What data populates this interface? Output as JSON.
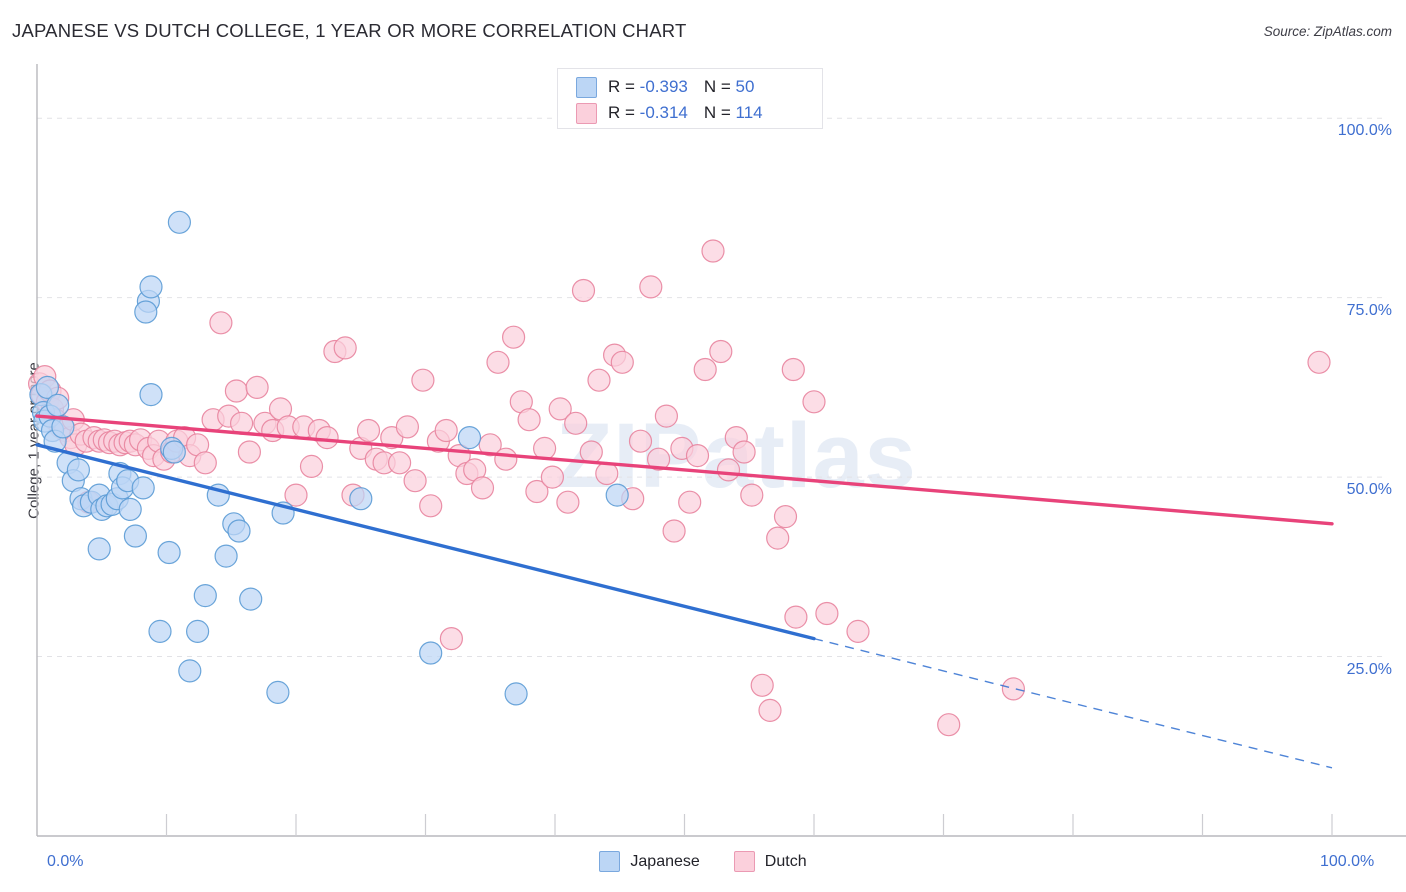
{
  "title": "JAPANESE VS DUTCH COLLEGE, 1 YEAR OR MORE CORRELATION CHART",
  "source": "Source: ZipAtlas.com",
  "watermark": "ZIPatlas",
  "stats": {
    "rows": [
      {
        "series": "Japanese",
        "r_label": "R = ",
        "r_value": "-0.393",
        "n_label": "N = ",
        "n_value": "50",
        "color": "#bcd6f5"
      },
      {
        "series": "Dutch",
        "r_label": "R = ",
        "r_value": "-0.314",
        "n_label": "N = ",
        "n_value": "114",
        "color": "#fbd0dc"
      }
    ]
  },
  "legend": {
    "position": "bottom-center",
    "entries": [
      {
        "label": "Japanese",
        "color": "#bcd6f5",
        "stroke": "#5b9bd5"
      },
      {
        "label": "Dutch",
        "color": "#fbd0dc",
        "stroke": "#e8849f"
      }
    ]
  },
  "chart_data": {
    "type": "scatter",
    "title": "JAPANESE VS DUTCH COLLEGE, 1 YEAR OR MORE CORRELATION CHART",
    "xlabel": "",
    "ylabel": "College, 1 year or more",
    "xlim": [
      0,
      100
    ],
    "ylim": [
      0,
      107
    ],
    "grid": true,
    "xticks": [
      0,
      100
    ],
    "xtick_labels": [
      "0.0%",
      "100.0%"
    ],
    "yticks": [
      25,
      50,
      75,
      100
    ],
    "ytick_labels": [
      "25.0%",
      "50.0%",
      "75.0%",
      "100.0%"
    ],
    "series": [
      {
        "name": "Japanese",
        "color": "#bcd6f5",
        "stroke": "#5b9bd5",
        "r": -0.393,
        "n": 50,
        "trendline": {
          "x0": 0,
          "y0": 54.5,
          "x1": 60,
          "y1": 27.5,
          "x2": 100,
          "y2": 9.5,
          "solid_to_x": 60,
          "color": "#2f6fd0"
        },
        "points": [
          [
            0.3,
            61.5
          ],
          [
            0.5,
            59.0
          ],
          [
            0.6,
            57.8
          ],
          [
            0.8,
            62.5
          ],
          [
            1.0,
            58.5
          ],
          [
            1.2,
            56.5
          ],
          [
            1.4,
            55.0
          ],
          [
            1.6,
            60.0
          ],
          [
            2.0,
            57.0
          ],
          [
            2.4,
            52.0
          ],
          [
            2.8,
            49.5
          ],
          [
            3.2,
            51.0
          ],
          [
            3.4,
            47.0
          ],
          [
            3.6,
            46.0
          ],
          [
            4.2,
            46.5
          ],
          [
            4.8,
            47.5
          ],
          [
            5.0,
            45.5
          ],
          [
            5.4,
            46.0
          ],
          [
            5.8,
            46.2
          ],
          [
            6.2,
            47.0
          ],
          [
            6.4,
            50.5
          ],
          [
            6.6,
            48.5
          ],
          [
            7.0,
            49.5
          ],
          [
            7.2,
            45.5
          ],
          [
            4.8,
            40.0
          ],
          [
            7.6,
            41.8
          ],
          [
            8.2,
            48.5
          ],
          [
            8.6,
            74.5
          ],
          [
            8.8,
            76.5
          ],
          [
            8.4,
            73.0
          ],
          [
            8.8,
            61.5
          ],
          [
            9.5,
            28.5
          ],
          [
            10.2,
            39.5
          ],
          [
            10.4,
            54.0
          ],
          [
            10.6,
            53.5
          ],
          [
            11.0,
            85.5
          ],
          [
            11.8,
            23.0
          ],
          [
            12.4,
            28.5
          ],
          [
            13.0,
            33.5
          ],
          [
            14.0,
            47.5
          ],
          [
            14.6,
            39.0
          ],
          [
            15.2,
            43.5
          ],
          [
            15.6,
            42.5
          ],
          [
            16.5,
            33.0
          ],
          [
            18.6,
            20.0
          ],
          [
            19.0,
            45.0
          ],
          [
            25.0,
            47.0
          ],
          [
            30.4,
            25.5
          ],
          [
            33.4,
            55.5
          ],
          [
            37.0,
            19.8
          ],
          [
            44.8,
            47.5
          ]
        ]
      },
      {
        "name": "Dutch",
        "color": "#fbd0dc",
        "stroke": "#e8849f",
        "r": -0.314,
        "n": 114,
        "trendline": {
          "x0": 0,
          "y0": 58.5,
          "x1": 100,
          "y1": 43.5,
          "color": "#e8437a"
        },
        "points": [
          [
            0.2,
            63.0
          ],
          [
            0.4,
            61.5
          ],
          [
            0.6,
            64.0
          ],
          [
            0.8,
            60.5
          ],
          [
            1.0,
            62.0
          ],
          [
            1.2,
            59.5
          ],
          [
            1.4,
            58.0
          ],
          [
            1.6,
            61.0
          ],
          [
            1.8,
            57.0
          ],
          [
            2.2,
            56.5
          ],
          [
            2.6,
            55.5
          ],
          [
            2.8,
            58.0
          ],
          [
            3.0,
            54.5
          ],
          [
            3.4,
            56.0
          ],
          [
            3.8,
            55.0
          ],
          [
            4.0,
            46.5
          ],
          [
            4.4,
            55.5
          ],
          [
            4.8,
            55.0
          ],
          [
            5.2,
            55.2
          ],
          [
            5.6,
            54.8
          ],
          [
            6.0,
            55.0
          ],
          [
            6.4,
            54.5
          ],
          [
            6.8,
            54.8
          ],
          [
            7.2,
            55.0
          ],
          [
            7.6,
            54.5
          ],
          [
            8.0,
            55.2
          ],
          [
            8.6,
            54.0
          ],
          [
            9.0,
            53.0
          ],
          [
            9.4,
            55.0
          ],
          [
            9.8,
            52.5
          ],
          [
            10.4,
            53.5
          ],
          [
            10.8,
            55.0
          ],
          [
            11.4,
            55.5
          ],
          [
            11.8,
            53.0
          ],
          [
            12.4,
            54.5
          ],
          [
            13.0,
            52.0
          ],
          [
            13.6,
            58.0
          ],
          [
            14.2,
            71.5
          ],
          [
            14.8,
            58.5
          ],
          [
            15.4,
            62.0
          ],
          [
            15.8,
            57.5
          ],
          [
            16.4,
            53.5
          ],
          [
            17.0,
            62.5
          ],
          [
            17.6,
            57.5
          ],
          [
            18.2,
            56.5
          ],
          [
            18.8,
            59.5
          ],
          [
            19.4,
            57.0
          ],
          [
            20.0,
            47.5
          ],
          [
            20.6,
            57.0
          ],
          [
            21.2,
            51.5
          ],
          [
            21.8,
            56.5
          ],
          [
            22.4,
            55.5
          ],
          [
            23.0,
            67.5
          ],
          [
            23.8,
            68.0
          ],
          [
            24.4,
            47.5
          ],
          [
            25.0,
            54.0
          ],
          [
            25.6,
            56.5
          ],
          [
            26.2,
            52.5
          ],
          [
            26.8,
            52.0
          ],
          [
            27.4,
            55.5
          ],
          [
            28.0,
            52.0
          ],
          [
            28.6,
            57.0
          ],
          [
            29.2,
            49.5
          ],
          [
            29.8,
            63.5
          ],
          [
            30.4,
            46.0
          ],
          [
            31.0,
            55.0
          ],
          [
            31.6,
            56.5
          ],
          [
            32.0,
            27.5
          ],
          [
            32.6,
            53.0
          ],
          [
            33.2,
            50.5
          ],
          [
            33.8,
            51.0
          ],
          [
            34.4,
            48.5
          ],
          [
            35.0,
            54.5
          ],
          [
            35.6,
            66.0
          ],
          [
            36.2,
            52.5
          ],
          [
            36.8,
            69.5
          ],
          [
            37.4,
            60.5
          ],
          [
            38.0,
            58.0
          ],
          [
            38.6,
            48.0
          ],
          [
            39.2,
            54.0
          ],
          [
            39.8,
            50.0
          ],
          [
            40.4,
            59.5
          ],
          [
            41.0,
            46.5
          ],
          [
            41.6,
            57.5
          ],
          [
            42.2,
            76.0
          ],
          [
            42.8,
            53.5
          ],
          [
            43.4,
            63.5
          ],
          [
            44.0,
            50.5
          ],
          [
            44.6,
            67.0
          ],
          [
            45.2,
            66.0
          ],
          [
            46.0,
            47.0
          ],
          [
            46.6,
            55.0
          ],
          [
            47.4,
            76.5
          ],
          [
            48.0,
            52.5
          ],
          [
            48.6,
            58.5
          ],
          [
            49.2,
            42.5
          ],
          [
            49.8,
            54.0
          ],
          [
            50.4,
            46.5
          ],
          [
            51.0,
            53.0
          ],
          [
            51.6,
            65.0
          ],
          [
            52.2,
            81.5
          ],
          [
            52.8,
            67.5
          ],
          [
            53.4,
            51.0
          ],
          [
            54.0,
            55.5
          ],
          [
            54.6,
            53.5
          ],
          [
            55.2,
            47.5
          ],
          [
            56.0,
            21.0
          ],
          [
            56.6,
            17.5
          ],
          [
            57.2,
            41.5
          ],
          [
            57.8,
            44.5
          ],
          [
            58.4,
            65.0
          ],
          [
            60.0,
            60.5
          ],
          [
            58.6,
            30.5
          ],
          [
            61.0,
            31.0
          ],
          [
            63.4,
            28.5
          ],
          [
            70.4,
            15.5
          ],
          [
            75.4,
            20.5
          ],
          [
            99.0,
            66.0
          ]
        ]
      }
    ]
  }
}
